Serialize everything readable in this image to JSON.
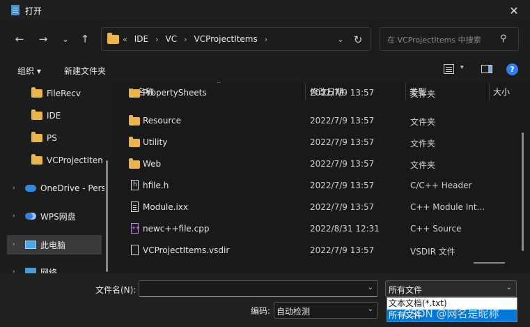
{
  "window": {
    "title": "打开",
    "close_glyph": "✕"
  },
  "nav": {
    "back": "←",
    "forward": "→",
    "recent": "⌄",
    "up": "↑"
  },
  "address": {
    "root_glyph": "«",
    "crumbs": [
      "IDE",
      "VC",
      "VCProjectItems"
    ],
    "sep": "›",
    "chevron": "⌄",
    "refresh": "↻"
  },
  "search": {
    "placeholder": "在 VCProjectItems 中搜索",
    "icon": "⚲"
  },
  "toolbar": {
    "organize": "组织 ▾",
    "new_folder": "新建文件夹",
    "view_chevron": "▾",
    "help": "?"
  },
  "sidebar": {
    "items": [
      {
        "label": "FileRecv",
        "icon": "folder-icon"
      },
      {
        "label": "IDE",
        "icon": "folder-icon"
      },
      {
        "label": "PS",
        "icon": "folder-icon"
      },
      {
        "label": "VCProjectItems",
        "icon": "folder-icon"
      },
      {
        "label": "OneDrive - Personal",
        "icon": "cloud-icon"
      },
      {
        "label": "WPS网盘",
        "icon": "wps-cloud-icon"
      },
      {
        "label": "此电脑",
        "icon": "pc-icon"
      },
      {
        "label": "网络",
        "icon": "network-icon"
      }
    ],
    "expand_glyph": "›"
  },
  "columns": {
    "name": "名称",
    "modified": "修改日期",
    "type": "类型",
    "size": "大小",
    "sort_glyph": "⌃"
  },
  "files": [
    {
      "name": "PropertySheets",
      "date": "2022/7/9 13:57",
      "type": "文件夹",
      "icon": "folder-icon"
    },
    {
      "name": "Resource",
      "date": "2022/7/9 13:57",
      "type": "文件夹",
      "icon": "folder-icon"
    },
    {
      "name": "Utility",
      "date": "2022/7/9 13:57",
      "type": "文件夹",
      "icon": "folder-icon"
    },
    {
      "name": "Web",
      "date": "2022/7/9 13:57",
      "type": "文件夹",
      "icon": "folder-icon"
    },
    {
      "name": "hfile.h",
      "date": "2022/7/9 13:57",
      "type": "C/C++ Header",
      "icon": "header-file-icon"
    },
    {
      "name": "Module.ixx",
      "date": "2022/7/9 13:57",
      "type": "C++ Module Int...",
      "icon": "file-icon"
    },
    {
      "name": "newc++file.cpp",
      "date": "2022/8/31 12:31",
      "type": "C++ Source",
      "icon": "cpp-file-icon"
    },
    {
      "name": "VCProjectItems.vsdir",
      "date": "2022/7/9 13:57",
      "type": "VSDIR 文件",
      "icon": "file-icon"
    }
  ],
  "bottom": {
    "filename_label": "文件名(N):",
    "filename_value": "",
    "filter_selected": "所有文件",
    "encoding_label": "编码:",
    "encoding_value": "自动检测",
    "chevron": "⌄",
    "filter_options": [
      "文本文档(*.txt)",
      "所有文件"
    ]
  },
  "watermark": "CSDN @网名是昵称"
}
